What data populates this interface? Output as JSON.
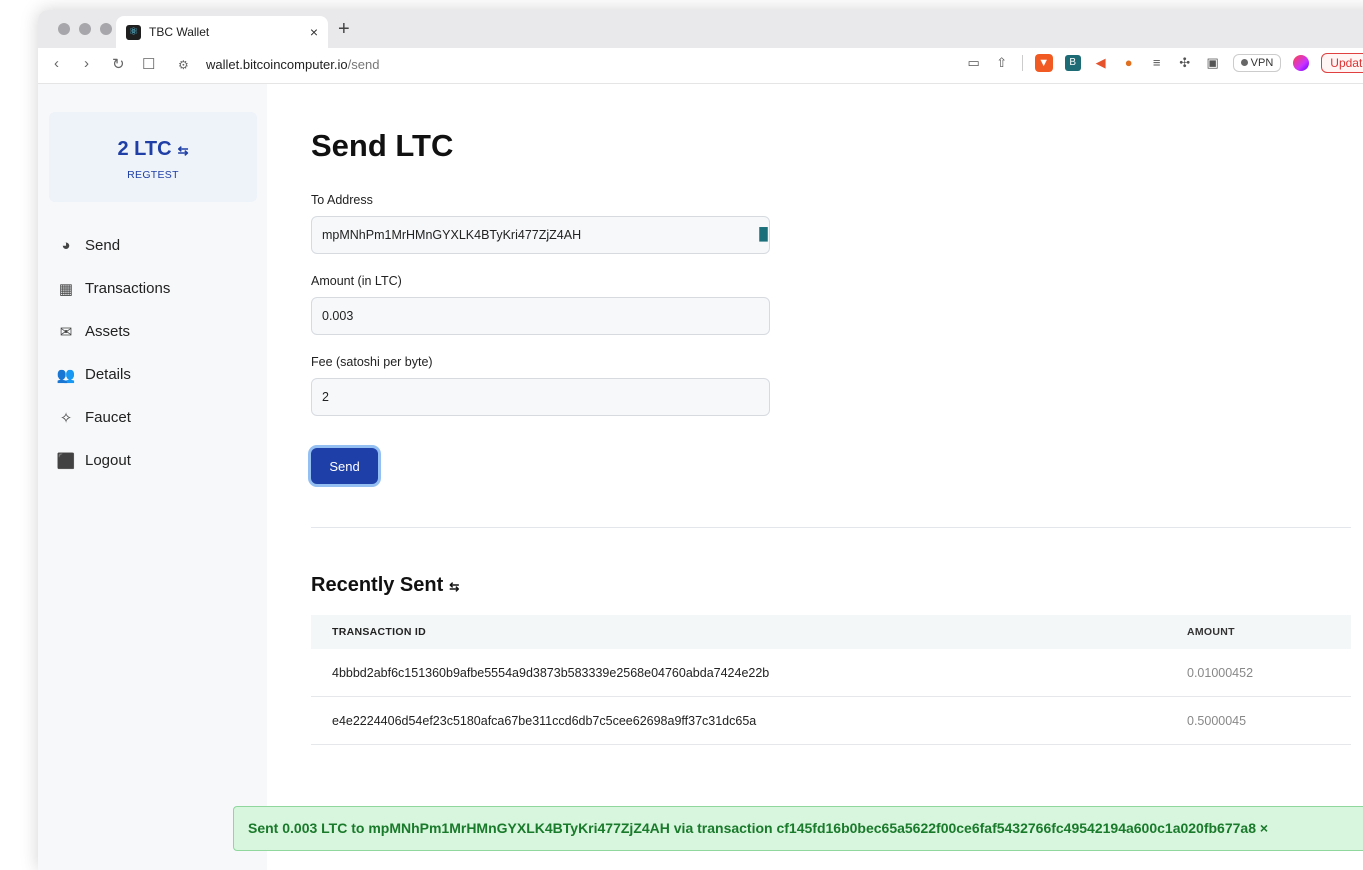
{
  "browser": {
    "tab_title": "TBC Wallet",
    "tab_close": "×",
    "new_tab": "+",
    "url_host": "wallet.bitcoincomputer.io",
    "url_path": "/send",
    "vpn_label": "VPN",
    "update_label": "Update"
  },
  "sidebar": {
    "balance": "2 LTC",
    "network": "REGTEST",
    "items": [
      {
        "label": "Send",
        "icon": "pie-chart-icon"
      },
      {
        "label": "Transactions",
        "icon": "grid-icon"
      },
      {
        "label": "Assets",
        "icon": "mailbox-icon"
      },
      {
        "label": "Details",
        "icon": "users-icon"
      },
      {
        "label": "Faucet",
        "icon": "magic-wand-icon"
      },
      {
        "label": "Logout",
        "icon": "bag-icon"
      }
    ]
  },
  "main": {
    "title": "Send LTC",
    "to_address_label": "To Address",
    "to_address_value": "mpMNhPm1MrHMnGYXLK4BTyKri477ZjZ4AH",
    "amount_label": "Amount (in LTC)",
    "amount_value": "0.003",
    "fee_label": "Fee (satoshi per byte)",
    "fee_value": "2",
    "send_label": "Send"
  },
  "recent": {
    "title": "Recently Sent",
    "columns": [
      "TRANSACTION ID",
      "AMOUNT"
    ],
    "rows": [
      {
        "id": "4bbbd2abf6c151360b9afbe5554a9d3873b583339e2568e04760abda7424e22b",
        "amount": "0.01000452"
      },
      {
        "id": "e4e2224406d54ef23c5180afca67be311ccd6db7c5cee62698a9ff37c31dc65a",
        "amount": "0.5000045"
      }
    ]
  },
  "toast": {
    "message": "Sent 0.003 LTC to mpMNhPm1MrHMnGYXLK4BTyKri477ZjZ4AH via transaction cf145fd16b0bec65a5622f00ce6faf5432766fc49542194a600c1a020fb677a8",
    "close": "×"
  },
  "colors": {
    "accent": "#1e3fa8",
    "success_bg": "#d8f5dd",
    "success_text": "#197a2b"
  }
}
